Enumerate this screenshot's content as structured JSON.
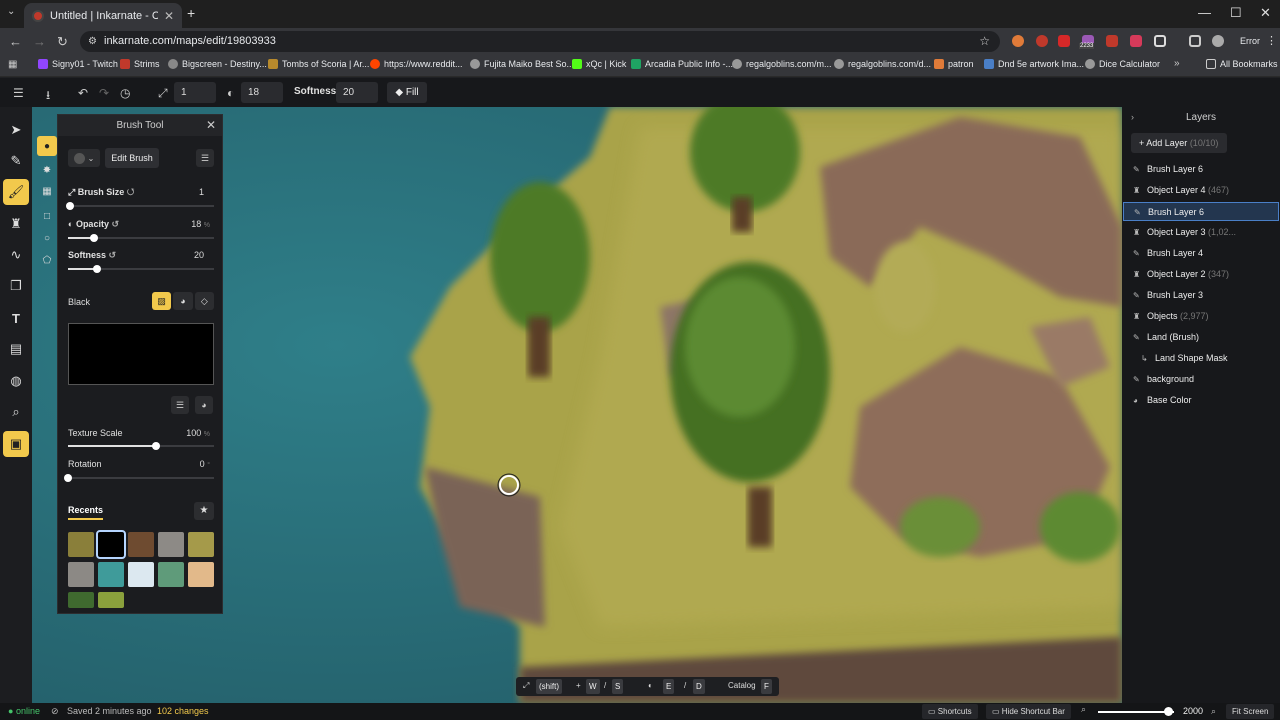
{
  "browser": {
    "tab_title": "Untitled | Inkarnate - Create Fa",
    "url": "inkarnate.com/maps/edit/19803933",
    "profile_label": "Error",
    "ext_badge": "2233",
    "bookmarks": [
      "Signy01 - Twitch",
      "Strims",
      "Bigscreen - Destiny...",
      "Tombs of Scoria | Ar...",
      "https://www.reddit...",
      "Fujita Maiko Best So...",
      "xQc | Kick",
      "Arcadia Public Info -...",
      "regalgoblins.com/m...",
      "regalgoblins.com/d...",
      "patron",
      "Dnd 5e artwork Ima...",
      "Dice Calculator"
    ],
    "all_bookmarks": "All Bookmarks"
  },
  "toolbar": {
    "size_value": "1",
    "opacity_value": "18",
    "softness_label": "Softness:",
    "softness_value": "20",
    "fill_label": "Fill"
  },
  "brush_panel": {
    "title": "Brush Tool",
    "edit_brush": "Edit Brush",
    "brush_size_label": "Brush Size",
    "brush_size_value": "1",
    "opacity_label": "Opacity",
    "opacity_value": "18",
    "softness_label": "Softness",
    "softness_value": "20",
    "color_name": "Black",
    "texture_scale_label": "Texture Scale",
    "texture_scale_value": "100",
    "rotation_label": "Rotation",
    "rotation_value": "0",
    "percent": "%",
    "degree": "°",
    "recents_label": "Recents",
    "opacity_fraction": 0.18,
    "softness_fraction": 0.2,
    "texture_fraction": 0.6,
    "rotation_fraction": 0.0,
    "recent_colors": [
      "#8a7f3a",
      "#000000",
      "#6e4b30",
      "#8d8a86",
      "#a59a4a",
      "#8c8985",
      "#3f9b9a",
      "#dce8f0",
      "#5f9b7a",
      "#e2b98a",
      "#3f6a2f",
      "#8aa03c"
    ]
  },
  "layers": {
    "title": "Layers",
    "add_layer": "Add Layer",
    "add_layer_count": "(10/10)",
    "items": [
      {
        "label": "Brush Layer 6",
        "count": "",
        "icon": "brush-icon",
        "active": false
      },
      {
        "label": "Object Layer 4",
        "count": "(467)",
        "icon": "tower-icon",
        "active": false
      },
      {
        "label": "Brush Layer 6",
        "count": "",
        "icon": "brush-icon",
        "active": true
      },
      {
        "label": "Object Layer 3",
        "count": "(1,02...",
        "icon": "tower-icon",
        "active": false
      },
      {
        "label": "Brush Layer 4",
        "count": "",
        "icon": "brush-icon",
        "active": false
      },
      {
        "label": "Object Layer 2",
        "count": "(347)",
        "icon": "tower-icon",
        "active": false
      },
      {
        "label": "Brush Layer 3",
        "count": "",
        "icon": "brush-icon",
        "active": false
      },
      {
        "label": "Objects",
        "count": "(2,977)",
        "icon": "tower-icon",
        "active": false
      },
      {
        "label": "Land (Brush)",
        "count": "",
        "icon": "brush-icon",
        "active": false
      },
      {
        "label": "Land Shape Mask",
        "count": "",
        "icon": "mask-icon",
        "active": false
      },
      {
        "label": "background",
        "count": "",
        "icon": "brush-icon",
        "active": false
      },
      {
        "label": "Base Color",
        "count": "",
        "icon": "palette-icon",
        "active": false
      }
    ]
  },
  "shortcut_bar": {
    "shift": "(shift)",
    "w": "W",
    "s": "S",
    "e": "E",
    "d": "D",
    "catalog": "Catalog",
    "f": "F"
  },
  "status": {
    "online": "online",
    "saved": "Saved 2 minutes ago",
    "changes": "102 changes",
    "shortcuts": "Shortcuts",
    "hide_shortcut_bar": "Hide Shortcut Bar",
    "zoom_value": "2000",
    "fit_screen": "Fit Screen",
    "zoom_fraction": 0.92
  },
  "colors": {
    "accent": "#f2c94c",
    "water": "#2f6f7a",
    "grass": "#a9a34a",
    "rock": "#8a6a58",
    "tree": "#4e7a28"
  }
}
